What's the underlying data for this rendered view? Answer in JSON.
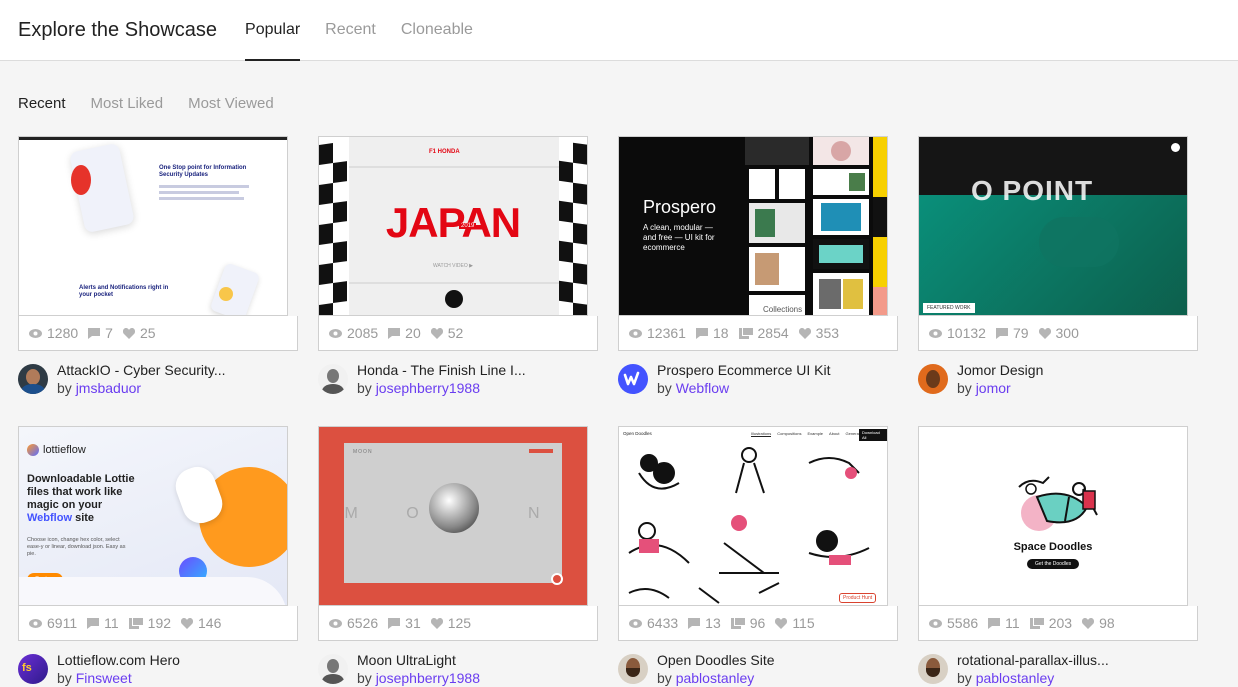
{
  "header": {
    "title": "Explore the Showcase",
    "tabs": [
      "Popular",
      "Recent",
      "Cloneable"
    ]
  },
  "subtabs": [
    "Recent",
    "Most Liked",
    "Most Viewed"
  ],
  "cards": [
    {
      "title": "AttackIO - Cyber Security...",
      "by": "by",
      "author": "jmsbaduor",
      "views": "1280",
      "comments": "7",
      "likes": "25",
      "thumb": {
        "headline": "One Stop point for Information Security Updates",
        "sub": "Alerts and Notifications right in your pocket"
      }
    },
    {
      "title": "Honda - The Finish Line I...",
      "by": "by",
      "author": "josephberry1988",
      "views": "2085",
      "comments": "20",
      "likes": "52",
      "thumb": {
        "brand": "F1 HONDA",
        "headline": "JAPAN",
        "year": "2019",
        "cta": "WATCH VIDEO ▶"
      }
    },
    {
      "title": "Prospero Ecommerce UI Kit",
      "by": "by",
      "author": "Webflow",
      "views": "12361",
      "comments": "18",
      "clones": "2854",
      "likes": "353",
      "thumb": {
        "headline": "Prospero",
        "sub": "A clean, modular — and free — UI kit for ecommerce",
        "tag": "Collections"
      }
    },
    {
      "title": "Jomor Design",
      "by": "by",
      "author": "jomor",
      "views": "10132",
      "comments": "79",
      "likes": "300",
      "thumb": {
        "headline": "O POINT",
        "badge": "FEATURED WORK"
      }
    },
    {
      "title": "Lottieflow.com Hero",
      "by": "by",
      "author": "Finsweet",
      "views": "6911",
      "comments": "11",
      "clones": "192",
      "likes": "146",
      "thumb": {
        "logo": "lottieflow",
        "headline1": "Downloadable Lottie files that work like magic on your",
        "headline2": "Webflow",
        "headline3": "site",
        "sub": "Choose icon, change hex color, select ease-y or linear, download json. Easy as pie.",
        "cta": "Explore"
      }
    },
    {
      "title": "Moon UltraLight",
      "by": "by",
      "author": "josephberry1988",
      "views": "6526",
      "comments": "31",
      "likes": "125",
      "thumb": {
        "logo": "MOON",
        "letters": "M O O N"
      }
    },
    {
      "title": "Open Doodles Site",
      "by": "by",
      "author": "pablostanley",
      "views": "6433",
      "comments": "13",
      "clones": "96",
      "likes": "115",
      "thumb": {
        "brand": "Open Doodles",
        "nav": [
          "Illustrations",
          "Compositions",
          "Example",
          "About",
          "Generator"
        ],
        "cta": "Download All",
        "badge": "Product Hunt"
      }
    },
    {
      "title": "rotational-parallax-illus...",
      "by": "by",
      "author": "pablostanley",
      "views": "5586",
      "comments": "11",
      "clones": "203",
      "likes": "98",
      "thumb": {
        "headline": "Space Doodles",
        "cta": "Get the Doodles"
      }
    }
  ],
  "colors": {
    "accent": "#6a3df0",
    "honda_red": "#e30613",
    "moon_bg": "#dc5040",
    "webflow": "#4353ff"
  },
  "icons": {
    "views": "eye-icon",
    "comments": "comment-icon",
    "clones": "clone-icon",
    "likes": "heart-icon"
  }
}
